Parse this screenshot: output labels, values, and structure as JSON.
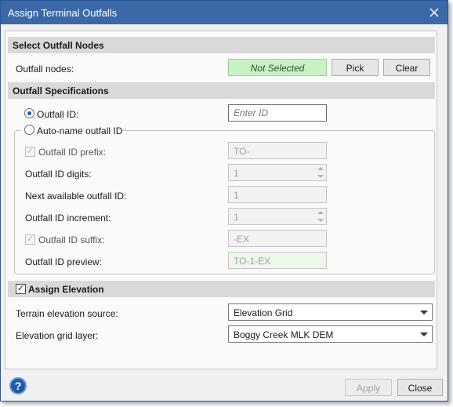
{
  "window": {
    "title": "Assign Terminal Outfalls"
  },
  "select_nodes": {
    "header": "Select Outfall Nodes",
    "label": "Outfall nodes:",
    "status": "Not Selected",
    "pick_label": "Pick",
    "clear_label": "Clear"
  },
  "specs": {
    "header": "Outfall Specifications",
    "outfall_id_label": "Outfall ID:",
    "outfall_id_placeholder": "Enter ID",
    "outfall_id_selected": true,
    "auto_name_label": "Auto-name outfall ID",
    "prefix_label": "Outfall ID prefix:",
    "prefix_value": "TO-",
    "digits_label": "Outfall ID digits:",
    "digits_value": "1",
    "next_label": "Next available outfall ID:",
    "next_value": "1",
    "increment_label": "Outfall ID increment:",
    "increment_value": "1",
    "suffix_label": "Outfall ID suffix:",
    "suffix_value": "-EX",
    "preview_label": "Outfall ID preview:",
    "preview_value": "TO-1-EX"
  },
  "elevation": {
    "header": "Assign Elevation",
    "checked": true,
    "source_label": "Terrain elevation source:",
    "source_value": "Elevation Grid",
    "grid_label": "Elevation grid layer:",
    "grid_value": "Boggy Creek MLK DEM"
  },
  "footer": {
    "help_icon": "question-mark-icon",
    "apply_label": "Apply",
    "close_label": "Close"
  },
  "colors": {
    "titlebar": "#3b69a8",
    "not_selected_bg": "#c8f2c4",
    "preview_bg": "#edf7ec",
    "help_icon": "#1f5aa8"
  }
}
